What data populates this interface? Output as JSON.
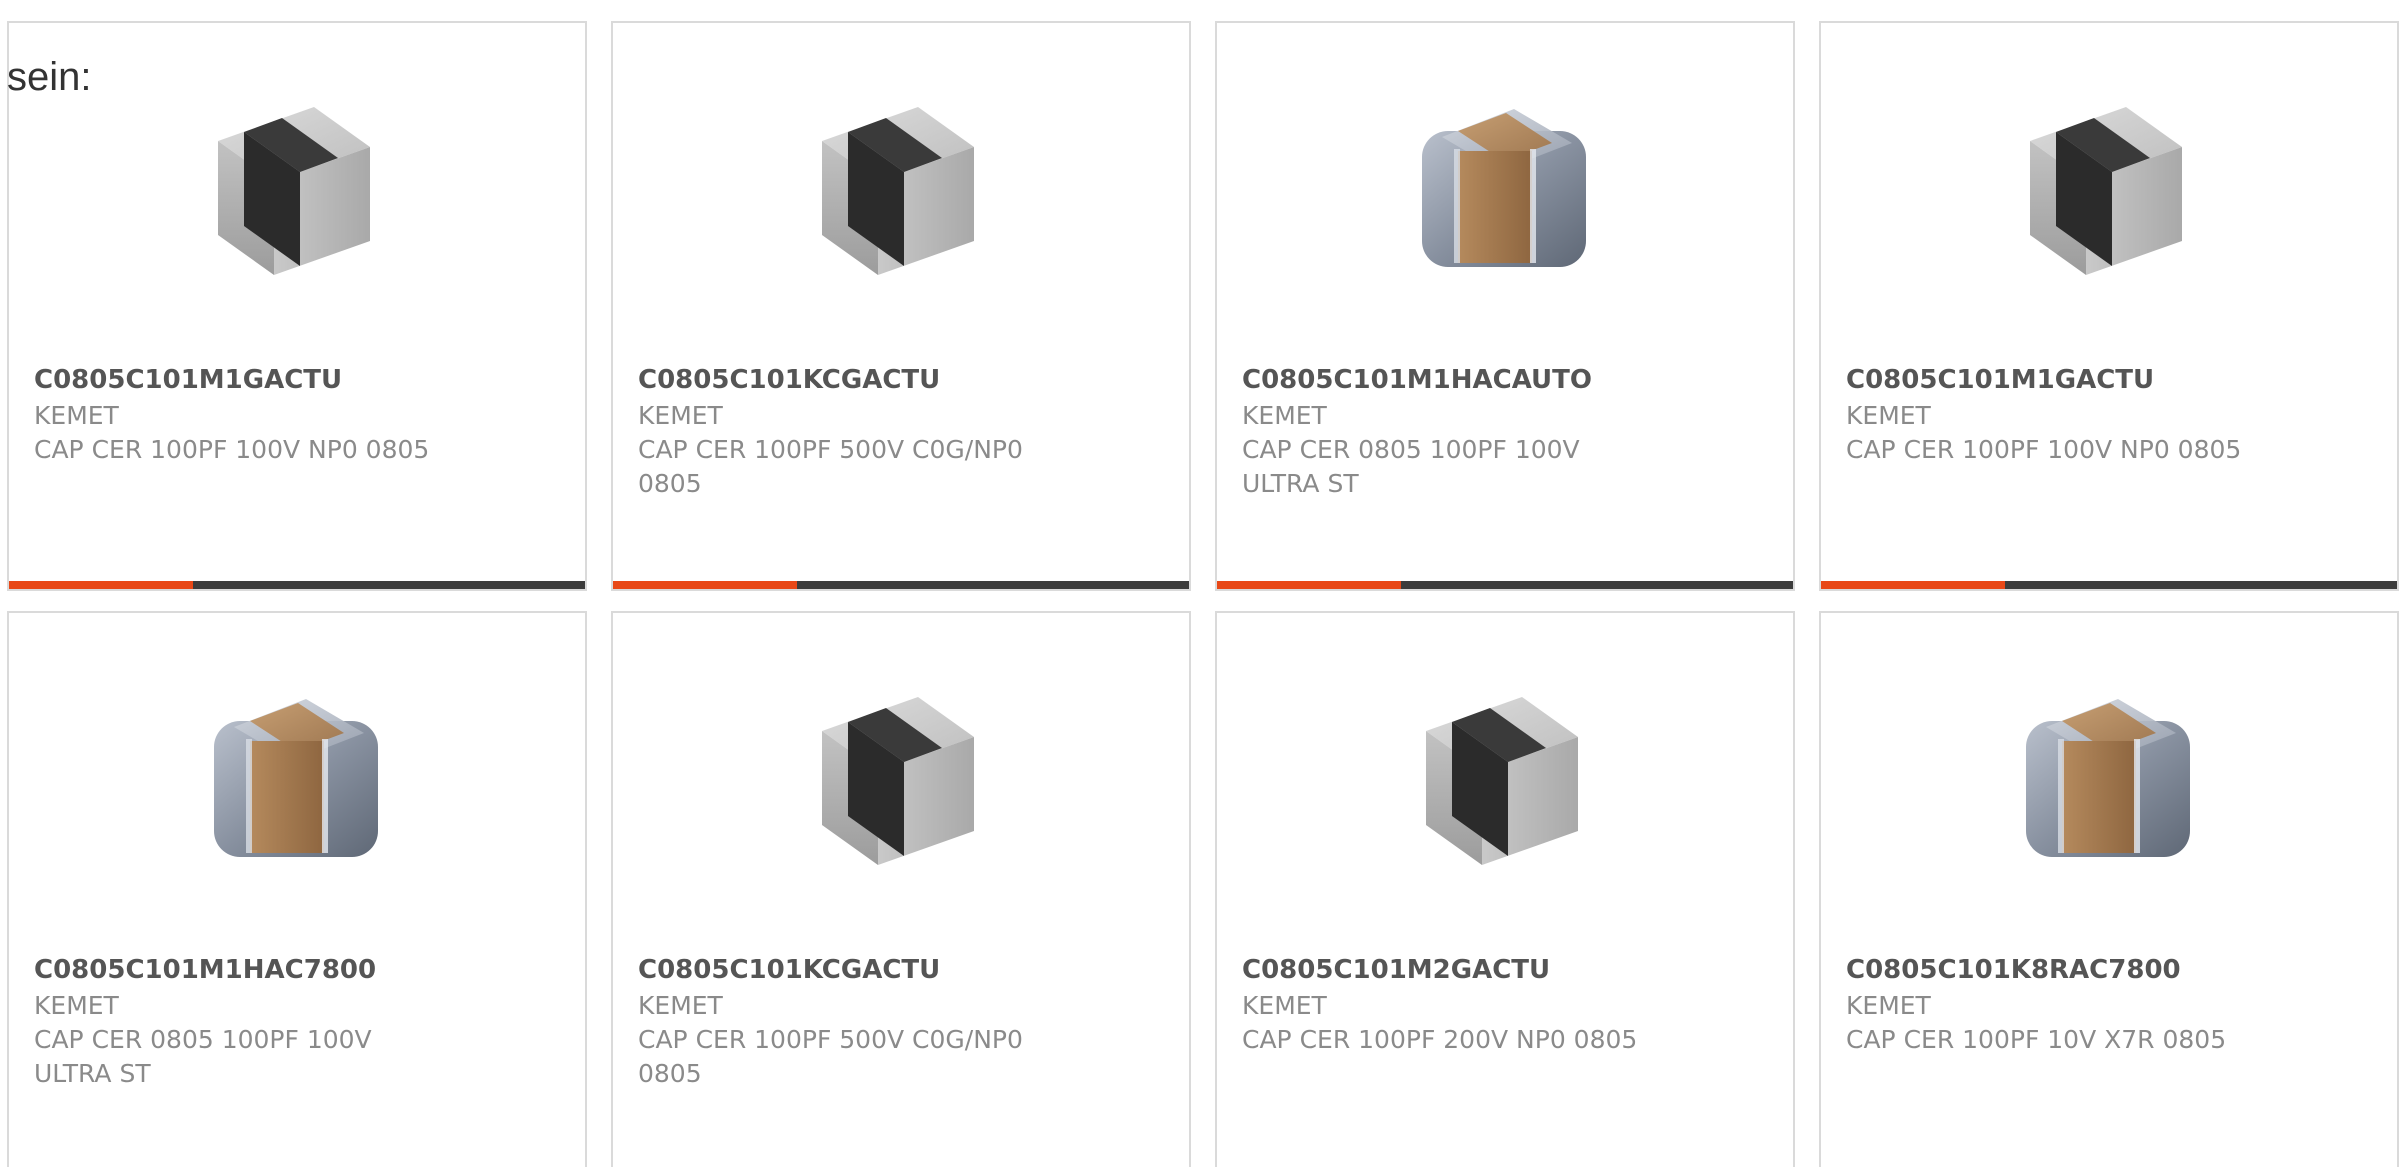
{
  "intro": {
    "text": "sein:"
  },
  "cards": [
    {
      "mpn": "C0805C101M1GACTU",
      "mfr": "KEMET",
      "desc": "CAP CER 100PF 100V NP0 0805",
      "image": "capacitor-black-band-icon",
      "progress": 0.32
    },
    {
      "mpn": "C0805C101KCGACTU",
      "mfr": "KEMET",
      "desc": "CAP CER 100PF 500V C0G/NP0 0805",
      "image": "capacitor-black-band-icon",
      "progress": 0.32
    },
    {
      "mpn": "C0805C101M1HACAUTO",
      "mfr": "KEMET",
      "desc": "CAP CER 0805 100PF 100V ULTRA ST",
      "image": "capacitor-brown-band-icon",
      "progress": 0.32
    },
    {
      "mpn": "C0805C101M1GACTU",
      "mfr": "KEMET",
      "desc": "CAP CER 100PF 100V NP0 0805",
      "image": "capacitor-black-band-icon",
      "progress": 0.32
    },
    {
      "mpn": "C0805C101M1HAC7800",
      "mfr": "KEMET",
      "desc": "CAP CER 0805 100PF 100V ULTRA ST",
      "image": "capacitor-brown-band-icon"
    },
    {
      "mpn": "C0805C101KCGACTU",
      "mfr": "KEMET",
      "desc": "CAP CER 100PF 500V C0G/NP0 0805",
      "image": "capacitor-black-band-icon"
    },
    {
      "mpn": "C0805C101M2GACTU",
      "mfr": "KEMET",
      "desc": "CAP CER 100PF 200V NP0 0805",
      "image": "capacitor-black-band-icon"
    },
    {
      "mpn": "C0805C101K8RAC7800",
      "mfr": "KEMET",
      "desc": "CAP CER 100PF 10V X7R 0805",
      "image": "capacitor-brown-band-icon"
    }
  ],
  "colors": {
    "accent": "#e84817",
    "bar_track": "#3c3c3c",
    "border": "#dadada",
    "mpn_text": "#555555",
    "meta_text": "#8a8a8a"
  }
}
